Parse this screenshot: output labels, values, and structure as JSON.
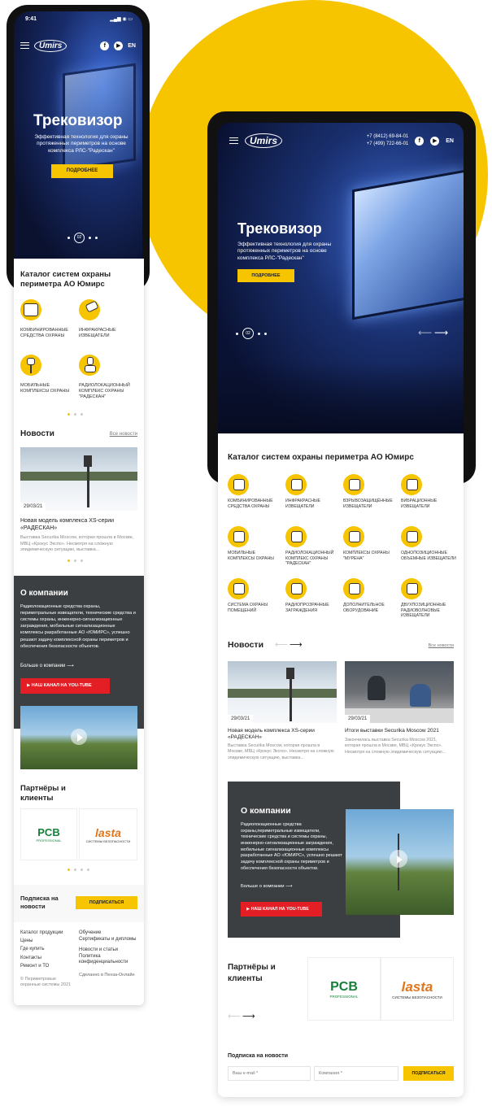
{
  "phone": {
    "status_time": "9:41",
    "brand": "Umirs",
    "social": [
      "f",
      "▶"
    ],
    "lang": "EN",
    "hero": {
      "title": "Трековизор",
      "subtitle": "Эффективная технология для охраны протяженных периметров на основе комплекса РЛС-\"Радескан\"",
      "button": "ПОДРОБНЕЕ",
      "slide": "02"
    },
    "catalog": {
      "title": "Каталог систем охраны периметра АО Юмирс",
      "items": [
        {
          "label": "КОМБИНИРОВАННЫЕ СРЕДСТВА ОХРАНЫ",
          "icon": "grid-box-icon"
        },
        {
          "label": "ИНФРАКРАСНЫЕ ИЗВЕЩАТЕЛИ",
          "icon": "ir-sensor-icon"
        },
        {
          "label": "МОБИЛЬНЫЕ КОМПЛЕКСЫ ОХРАНЫ",
          "icon": "tripod-icon"
        },
        {
          "label": "РАДИОЛОКАЦИОННЫЙ КОМПЛЕКС ОХРАНЫ \"РАДЕСКАН\"",
          "icon": "radar-icon"
        }
      ]
    },
    "news": {
      "title": "Новости",
      "all_link": "Все новости",
      "date": "29/03/21",
      "headline": "Новая модель комплекса XS-серии «РАДЕСКАН»",
      "excerpt": "Выставка Securika Moscow, которая прошла в Москве, МВЦ «Крокус Экспо». Несмотря на сложную эпидемическую ситуацию, выставка..."
    },
    "about": {
      "title": "О компании",
      "text": "Радиолокационные средства охраны, периметральные извещатели, технические средства и системы охраны, инженерно-сигнализационные заграждения, мобильные сигнализационные комплексы разработанные АО «ЮМИРС», успешно решают задачу комплексной охраны периметров и обеспечения безопасности объектов.",
      "more": "Больше о компании",
      "youtube": "НАШ КАНАЛ НА YOU-TUBE"
    },
    "partners": {
      "title": "Партнёры и клиенты",
      "pcb": "PCB",
      "pcb_sub": "PROFESSIONAL",
      "lasta": "lasta",
      "lasta_sub": "СИСТЕМЫ БЕЗОПАСНОСТИ"
    },
    "subscribe": {
      "title": "Подписка на новости",
      "button": "ПОДПИСАТЬСЯ"
    },
    "footer": {
      "col1": [
        "Каталог продукции",
        "Цены",
        "Где купить",
        "Контакты",
        "Ремонт и ТО"
      ],
      "col2": [
        "Обучение",
        "Сертификаты и дипломы",
        "Новости и статьи",
        "Политика конфиденциальности"
      ],
      "copyright": "© Периметровые охранные системы 2021",
      "made": "Сделанно в Пенза-Онлайн"
    }
  },
  "tablet": {
    "brand": "Umirs",
    "phone1": "+7 (8412) 69-84-01",
    "phone2": "+7 (499) 722-66-01",
    "lang": "EN",
    "hero": {
      "title": "Трековизор",
      "subtitle": "Эффективная технология для охраны протяженных периметров на основе комплекса РЛС-\"Радескан\"",
      "button": "ПОДРОБНЕЕ",
      "slide": "02"
    },
    "catalog": {
      "title": "Каталог систем охраны периметра АО Юмирс",
      "items": [
        {
          "label": "КОМБИНИРОВАННЫЕ СРЕДСТВА ОХРАНЫ",
          "icon": "grid-box-icon"
        },
        {
          "label": "ИНФРАКРАСНЫЕ ИЗВЕЩАТЕЛИ",
          "icon": "ir-sensor-icon"
        },
        {
          "label": "ВЗРЫВОЗАЩИЩЁННЫЕ ИЗВЕЩАТЕЛИ",
          "icon": "explosion-proof-icon"
        },
        {
          "label": "ВИБРАЦИОННЫЕ ИЗВЕЩАТЕЛИ",
          "icon": "vibration-icon"
        },
        {
          "label": "МОБИЛЬНЫЕ КОМПЛЕКСЫ ОХРАНЫ",
          "icon": "tripod-icon"
        },
        {
          "label": "РАДИОЛОКАЦИОННЫЙ КОМПЛЕКС ОХРАНЫ \"РАДЕСКАН\"",
          "icon": "radar-icon"
        },
        {
          "label": "КОМПЛЕКСЫ ОХРАНЫ \"МУРЕНА\"",
          "icon": "fence-wire-icon"
        },
        {
          "label": "ОДНОПОЗИЦИОННЫЕ ОБЪЕМНЫЕ ИЗВЕЩАТЕЛИ",
          "icon": "volume-sensor-icon"
        },
        {
          "label": "СИСТЕМА ОХРАНЫ ПОМЕЩЕНИЙ",
          "icon": "door-icon"
        },
        {
          "label": "РАДИОПРОЗРАЧНЫЕ ЗАГРАЖДЕНИЯ",
          "icon": "barrier-icon"
        },
        {
          "label": "ДОПОЛНИТЕЛЬНОЕ ОБОРУДОВАНИЕ",
          "icon": "equipment-icon"
        },
        {
          "label": "ДВУХПОЗИЦИОННЫЕ РАДИОВОЛНОВЫЕ ИЗВЕЩАТЕЛИ",
          "icon": "radiowave-icon"
        }
      ]
    },
    "news": {
      "title": "Новости",
      "all_link": "Все новости",
      "items": [
        {
          "date": "29/03/21",
          "headline": "Новая модель комплекса XS-серии «РАДЕСКАН»",
          "excerpt": "Выставка Securika Moscow, которая прошла в Москве, МВЦ «Крокус Экспо». Несмотря на сложную эпидемическую ситуацию, выставка..."
        },
        {
          "date": "29/03/21",
          "headline": "Итоги выставки Securika Moscow 2021",
          "excerpt": "Закончилась выставка Securika Moscow 2021, которая прошла в Москве, МВЦ «Крокус Экспо». Несмотря на сложную эпидемическую ситуацию..."
        }
      ]
    },
    "about": {
      "title": "О компании",
      "text": "Радиолокационные средства охраны,периметральные извещатели, технические средства и системы охраны, инженерно-сигнализационные заграждения, мобильные сигнализационные комплексы разработанные АО «ЮМИРС», успешно решают задачу комплексной охраны периметров и обеспечения безопасности объектов.",
      "more": "Больше о компании",
      "youtube": "НАШ КАНАЛ НА YOU-TUBE"
    },
    "partners": {
      "title": "Партнёры и клиенты",
      "pcb": "PCB",
      "pcb_sub": "PROFESSIONAL",
      "lasta": "lasta",
      "lasta_sub": "СИСТЕМЫ БЕЗОПАСНОСТИ"
    },
    "subscribe": {
      "title": "Подписка на новости",
      "email_placeholder": "Ваш e-mail *",
      "company_placeholder": "Компания *",
      "button": "ПОДПИСАТЬСЯ"
    }
  },
  "colors": {
    "accent": "#f7c400",
    "dark_panel": "#3c3f41",
    "youtube_red": "#e31e24"
  }
}
